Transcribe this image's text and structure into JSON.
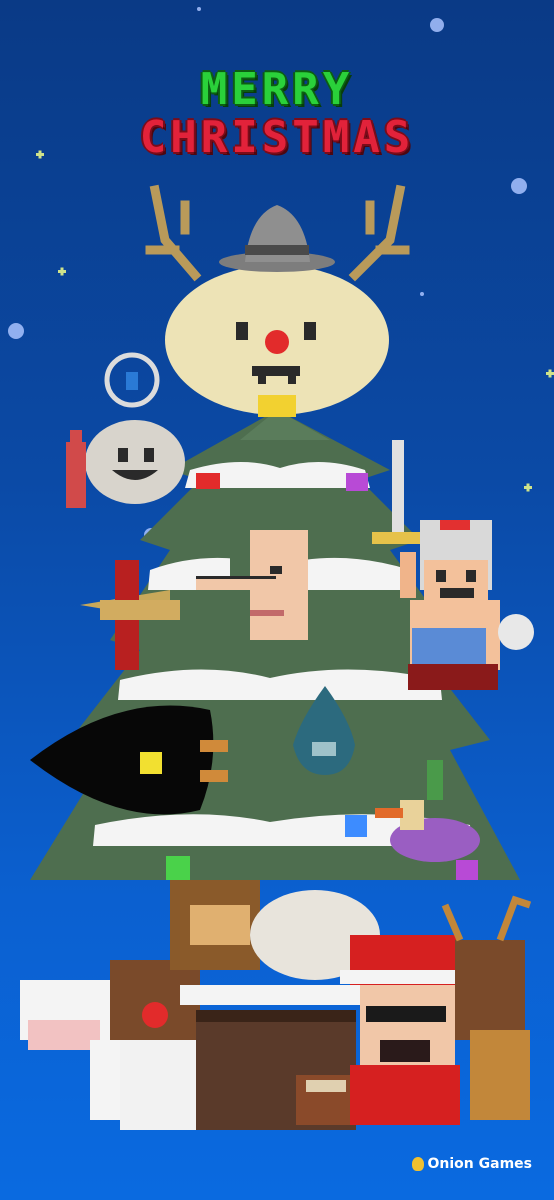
{
  "title": {
    "line1": "MERRY",
    "line2": "CHRISTMAS"
  },
  "brand": {
    "name": "Onion Games",
    "icon": "onion-icon"
  },
  "colors": {
    "sky_top": "#0a3a86",
    "sky_bottom": "#0a6ae0",
    "title_green": "#2ad13a",
    "title_red": "#e2223a",
    "tree_green": "#4a6a4c",
    "snow": "#f2f2f2"
  }
}
